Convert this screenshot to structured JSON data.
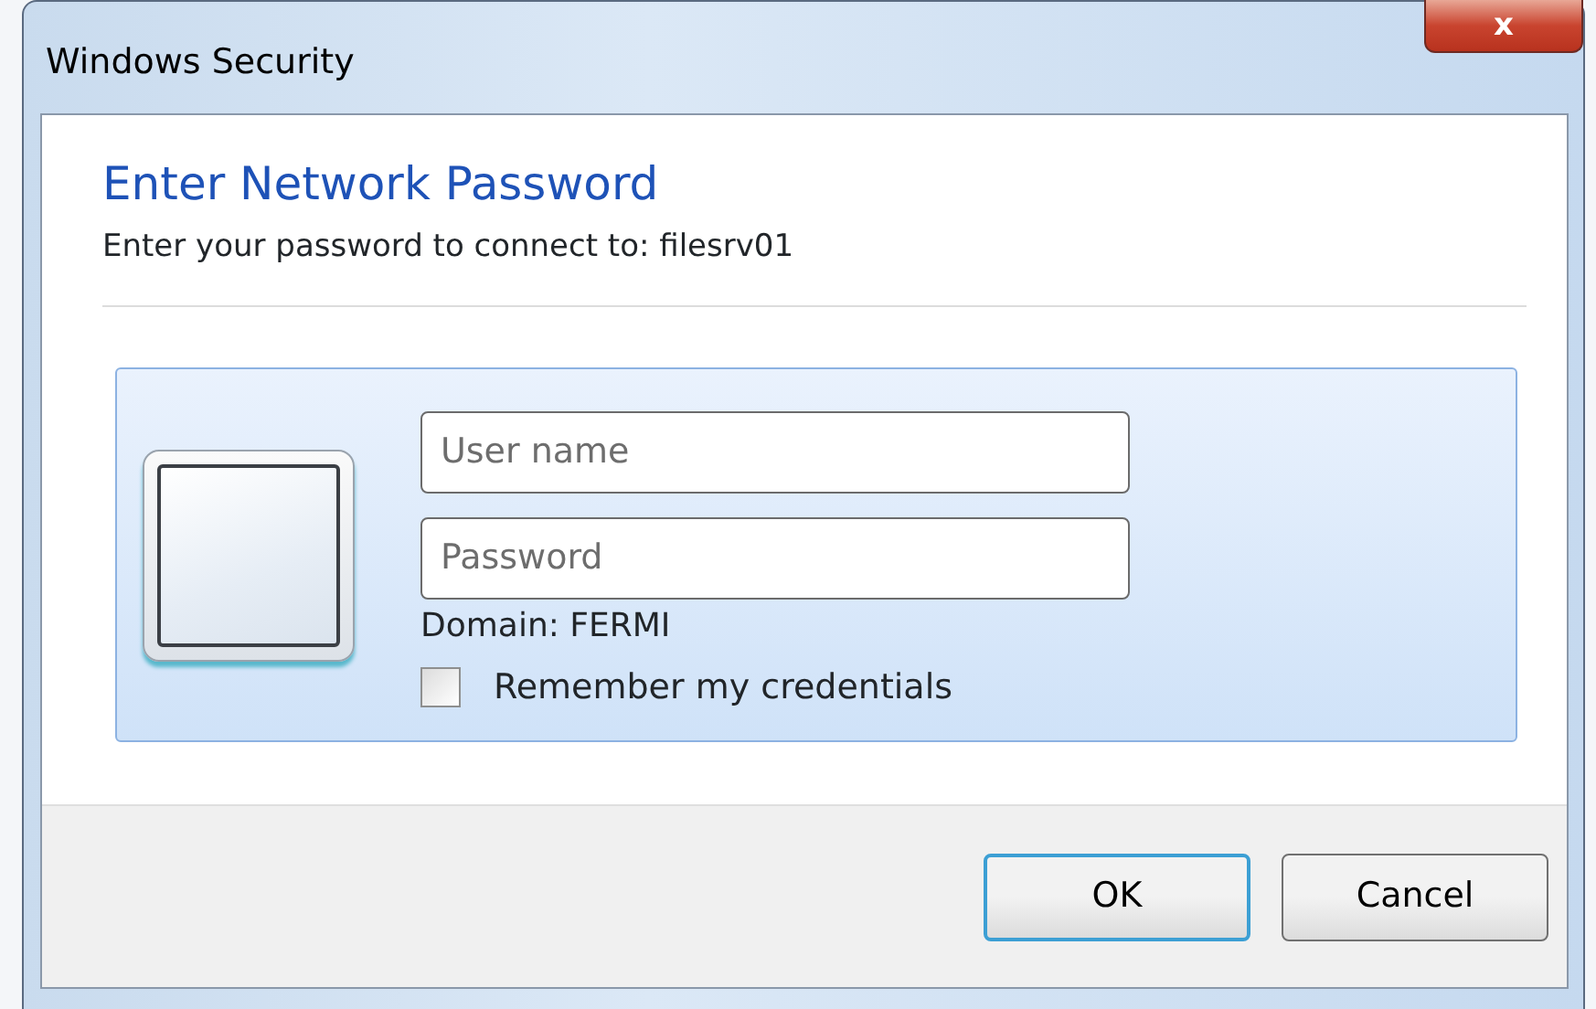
{
  "window": {
    "title": "Windows Security",
    "close_button": "x"
  },
  "heading": "Enter Network Password",
  "subtitle": "Enter your password to connect to: filesrv01",
  "credential": {
    "username": {
      "placeholder": "User name"
    },
    "password": {
      "placeholder": "Password"
    },
    "domain": "Domain: FERMI",
    "remember": {
      "label": "Remember my credentials",
      "checked": false
    }
  },
  "buttons": [
    {
      "label": "OK",
      "default": true
    },
    {
      "label": "Cancel",
      "default": false
    }
  ]
}
